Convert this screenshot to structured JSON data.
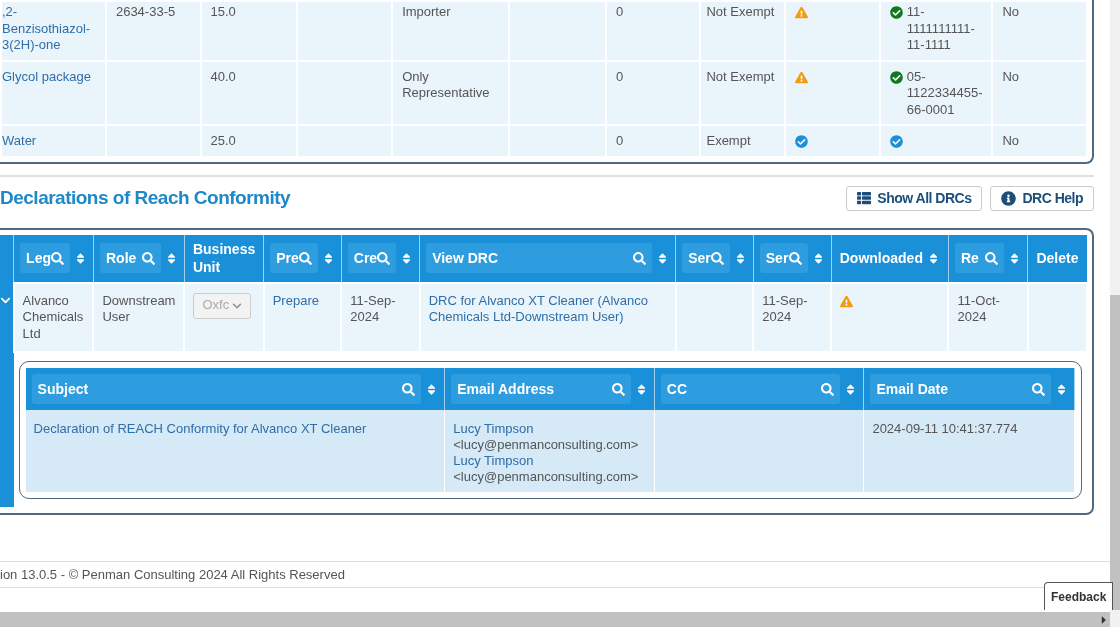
{
  "components_table": {
    "rows": [
      {
        "substance": ",2-Benzisothiazol-3(2H)-one",
        "cas_number": "2634-33-5",
        "concentration": "15.0",
        "role": "Importer",
        "column_7": "0",
        "exemption": "Not Exempt",
        "status": {
          "kind": "warning"
        },
        "registration": {
          "kind": "registered",
          "number": "11-1111111111-11-1111"
        },
        "column_11": "No"
      },
      {
        "substance": "Glycol package",
        "concentration": "40.0",
        "role": "Only Representative",
        "column_7": "0",
        "exemption": "Not Exempt",
        "status": {
          "kind": "warning"
        },
        "registration": {
          "kind": "registered",
          "number": "05-1122334455-66-0001"
        },
        "column_11": "No"
      },
      {
        "substance": "Water",
        "concentration": "25.0",
        "column_7": "0",
        "exemption": "Exempt",
        "status": {
          "kind": "ok"
        },
        "registration": {
          "kind": "exempt"
        },
        "column_11": "No"
      }
    ]
  },
  "drc_section": {
    "title": "Declarations of Reach Conformity",
    "buttons": [
      {
        "label": "Show All DRCs"
      },
      {
        "label": "DRC Help"
      }
    ],
    "table": {
      "columns": [
        {
          "label": "Leg",
          "filter": true,
          "sort": true
        },
        {
          "label": "Role",
          "filter": true,
          "sort": true
        },
        {
          "label": "Business Unit",
          "filter": false,
          "sort": false
        },
        {
          "label": "Pre",
          "filter": true,
          "sort": true
        },
        {
          "label": "Cre",
          "filter": true,
          "sort": true
        },
        {
          "label": "View DRC",
          "filter": true,
          "sort": true
        },
        {
          "label": "Ser",
          "filter": true,
          "sort": true
        },
        {
          "label": "Ser",
          "filter": true,
          "sort": true
        },
        {
          "label": "Downloaded",
          "filter": false,
          "sort": true
        },
        {
          "label": "Re",
          "filter": true,
          "sort": true
        },
        {
          "label": "Delete",
          "filter": false,
          "sort": false
        }
      ],
      "rows": [
        {
          "expanded": true,
          "cells": [
            {
              "kind": "text",
              "text": "Alvanco Chemicals Ltd"
            },
            {
              "kind": "text",
              "text": "Downstream User"
            },
            {
              "kind": "select",
              "text": "Oxfc",
              "disabled": true
            },
            {
              "kind": "link",
              "text": "Prepare"
            },
            {
              "kind": "text",
              "text": "11-Sep-2024"
            },
            {
              "kind": "link",
              "text": "DRC for Alvanco XT Cleaner (Alvanco Chemicals Ltd-Downstream User)"
            },
            {
              "kind": "empty"
            },
            {
              "kind": "text",
              "text": "11-Sep-2024"
            },
            {
              "kind": "warning"
            },
            {
              "kind": "text",
              "text": "11-Oct-2024"
            },
            {
              "kind": "empty"
            }
          ],
          "emails": {
            "columns": [
              {
                "label": "Subject",
                "filter": true,
                "sort": true
              },
              {
                "label": "Email Address",
                "filter": true,
                "sort": true
              },
              {
                "label": "CC",
                "filter": true,
                "sort": true
              },
              {
                "label": "Email Date",
                "filter": true,
                "sort": true
              }
            ],
            "rows": [
              {
                "cells": [
                  {
                    "kind": "link",
                    "text": "Declaration of REACH Conformity for Alvanco XT Cleaner"
                  },
                  {
                    "kind": "recipients",
                    "recipients": [
                      {
                        "name": "Lucy Timpson",
                        "address": "<lucy@penmanconsulting.com>"
                      },
                      {
                        "name": "Lucy Timpson",
                        "address": "<lucy@penmanconsulting.com>"
                      }
                    ]
                  },
                  {
                    "kind": "empty"
                  },
                  {
                    "kind": "text",
                    "text": "2024-09-11 10:41:37.774"
                  }
                ]
              }
            ]
          }
        }
      ]
    }
  },
  "footer": {
    "text": "ion 13.0.5 - © Penman Consulting 2024 All Rights Reserved"
  },
  "feedback_button": {
    "label": "Feedback"
  }
}
